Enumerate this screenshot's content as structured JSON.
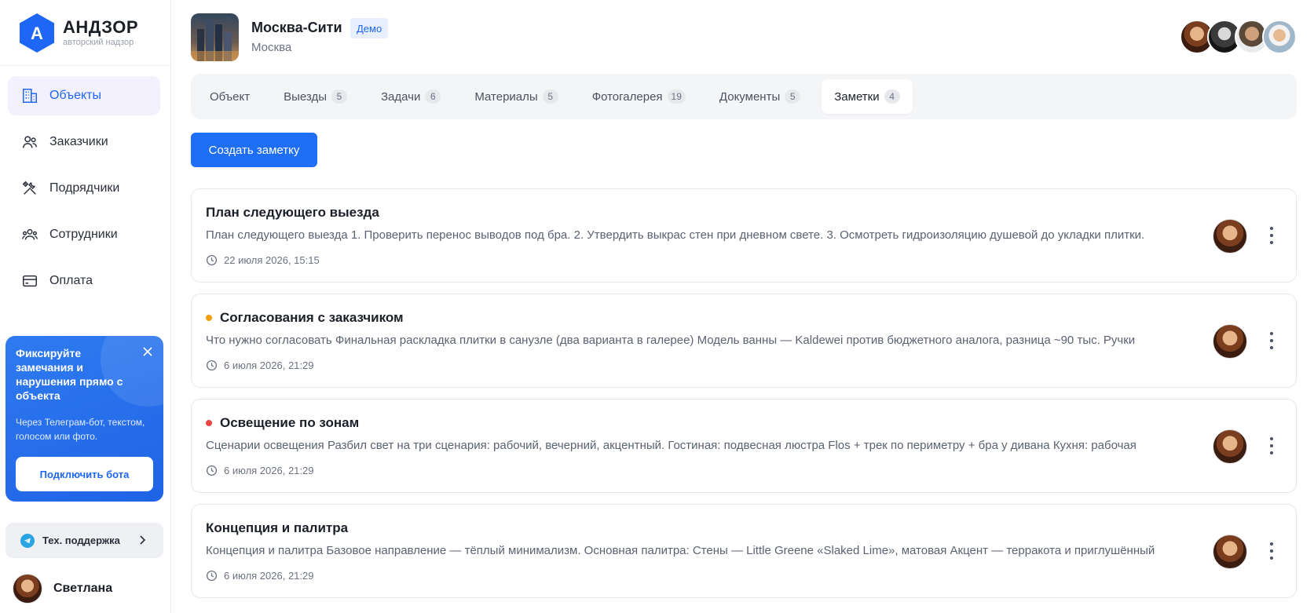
{
  "app": {
    "logo_letter": "А",
    "title": "АНДЗОР",
    "subtitle": "авторский надзор",
    "brand_color": "#1e66f5"
  },
  "sidebar": {
    "items": [
      {
        "label": "Объекты",
        "icon": "building-icon",
        "active": true
      },
      {
        "label": "Заказчики",
        "icon": "users-icon",
        "active": false
      },
      {
        "label": "Подрядчики",
        "icon": "tools-icon",
        "active": false
      },
      {
        "label": "Сотрудники",
        "icon": "team-icon",
        "active": false
      },
      {
        "label": "Оплата",
        "icon": "credit-card-icon",
        "active": false
      }
    ],
    "promo": {
      "title": "Фиксируйте замечания и нарушения прямо с объекта",
      "description": "Через Телеграм-бот, текстом, голосом или фото.",
      "button_label": "Подключить бота"
    },
    "support_label": "Тех. поддержка",
    "user_name": "Светлана"
  },
  "project": {
    "title": "Москва-Сити",
    "badge": "Демо",
    "city": "Москва"
  },
  "tabs": [
    {
      "label": "Объект",
      "count": null,
      "active": false
    },
    {
      "label": "Выезды",
      "count": "5",
      "active": false
    },
    {
      "label": "Задачи",
      "count": "6",
      "active": false
    },
    {
      "label": "Материалы",
      "count": "5",
      "active": false
    },
    {
      "label": "Фотогалерея",
      "count": "19",
      "active": false
    },
    {
      "label": "Документы",
      "count": "5",
      "active": false
    },
    {
      "label": "Заметки",
      "count": "4",
      "active": true
    }
  ],
  "actions": {
    "create_note_label": "Создать заметку"
  },
  "notes": [
    {
      "title": "План следующего выезда",
      "marker_color": null,
      "text": "План следующего выезда 1. Проверить перенос выводов под бра. 2. Утвердить выкрас стен при дневном свете. 3. Осмотреть гидроизоляцию душевой до укладки плитки.",
      "date": "22 июля 2026, 15:15"
    },
    {
      "title": "Согласования с заказчиком",
      "marker_color": "#f59e0b",
      "text": "Что нужно согласовать Финальная раскладка плитки в санузле (два варианта в галерее) Модель ванны — Kaldewei против бюджетного аналога, разница ~90 тыс. Ручки",
      "date": "6 июля 2026, 21:29"
    },
    {
      "title": "Освещение по зонам",
      "marker_color": "#ef4444",
      "text": "Сценарии освещения Разбил свет на три сценария: рабочий, вечерний, акцентный. Гостиная: подвесная люстра Flos + трек по периметру + бра у дивана Кухня: рабочая",
      "date": "6 июля 2026, 21:29"
    },
    {
      "title": "Концепция и палитра",
      "marker_color": null,
      "text": "Концепция и палитра Базовое направление — тёплый минимализм. Основная палитра: Стены — Little Greene «Slaked Lime», матовая Акцент — терракота и приглушённый",
      "date": "6 июля 2026, 21:29"
    }
  ]
}
